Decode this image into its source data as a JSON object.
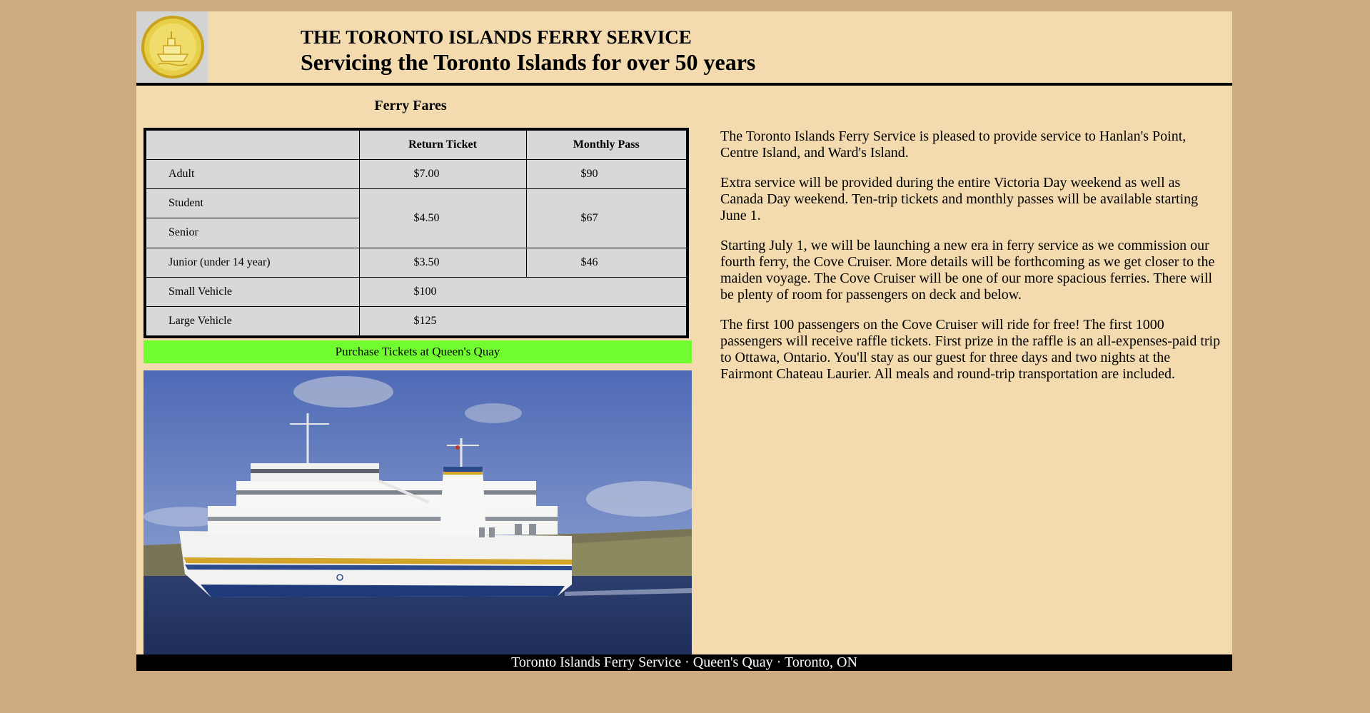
{
  "header": {
    "title": "THE TORONTO ISLANDS FERRY SERVICE",
    "subtitle": "Servicing the Toronto Islands for over 50 years"
  },
  "fares": {
    "heading": "Ferry Fares",
    "columns": [
      "",
      "Return Ticket",
      "Monthly Pass"
    ],
    "rows": {
      "adult": {
        "label": "Adult",
        "return": "$7.00",
        "monthly": "$90"
      },
      "student": {
        "label": "Student"
      },
      "senior": {
        "label": "Senior"
      },
      "student_senior": {
        "return": "$4.50",
        "monthly": "$67"
      },
      "junior": {
        "label": "Junior (under 14 year)",
        "return": "$3.50",
        "monthly": "$46"
      },
      "small_vehicle": {
        "label": "Small Vehicle",
        "return": "$100"
      },
      "large_vehicle": {
        "label": "Large Vehicle",
        "return": "$125"
      }
    }
  },
  "purchase_banner": "Purchase Tickets at Queen's Quay",
  "info_paragraphs": [
    "The Toronto Islands Ferry Service is pleased to provide service to Hanlan's Point, Centre Island, and Ward's Island.",
    "Extra service will be provided during the entire Victoria Day weekend as well as Canada Day weekend. Ten-trip tickets and monthly passes will be available starting June 1.",
    "Starting July 1, we will be launching a new era in ferry service as we commission our fourth ferry, the Cove Cruiser. More details will be forthcoming as we get closer to the maiden voyage. The Cove Cruiser will be one of our more spacious ferries. There will be plenty of room for passengers on deck and below.",
    "The first 100 passengers on the Cove Cruiser will ride for free! The first 1000 passengers will receive raffle tickets. First prize in the raffle is an all-expenses-paid trip to Ottawa, Ontario. You'll stay as our guest for three days and two nights at the Fairmont Chateau Laurier. All meals and round-trip transportation are included."
  ],
  "footer": "Toronto Islands Ferry Service · Queen's Quay · Toronto, ON",
  "colors": {
    "page_background": "#cdaa80",
    "content_background": "#f3dbaf",
    "table_background": "#d8d8d8",
    "banner_green": "#71fc2f",
    "footer_background": "#000000"
  },
  "icons": {
    "logo": "ferry-coin-logo-icon"
  }
}
